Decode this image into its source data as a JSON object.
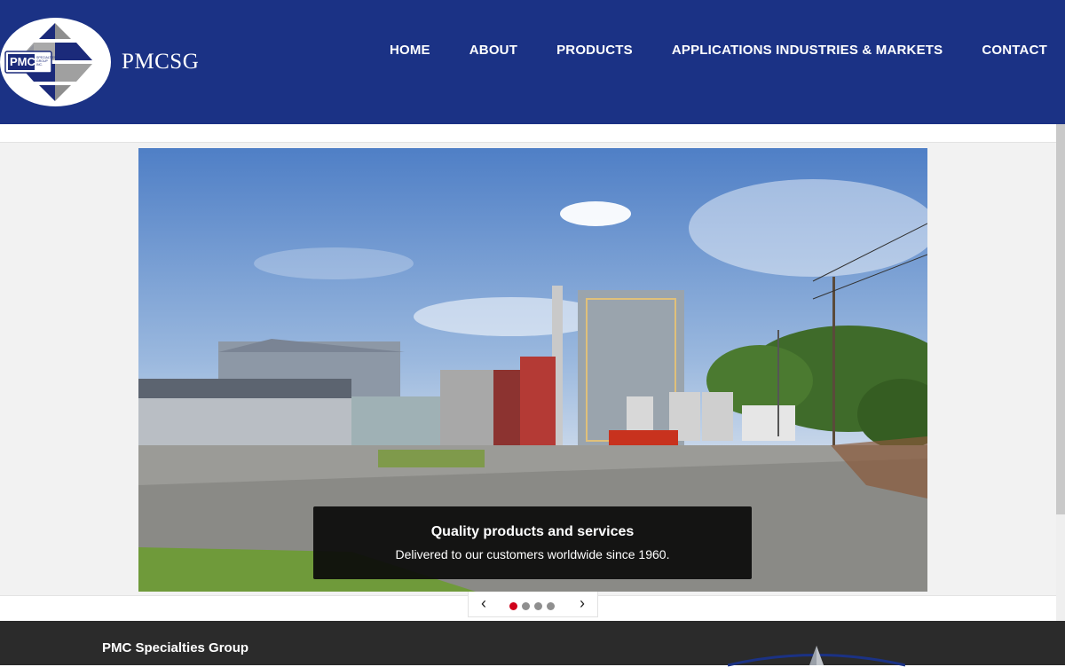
{
  "header": {
    "logo_text": "PMC",
    "logo_subtext": "SPECIALTIES GROUP INC.",
    "site_title": "PMCSG"
  },
  "nav": {
    "items": [
      {
        "label": "HOME"
      },
      {
        "label": "ABOUT"
      },
      {
        "label": "PRODUCTS"
      },
      {
        "label": "APPLICATIONS INDUSTRIES & MARKETS"
      },
      {
        "label": "CONTACT"
      }
    ]
  },
  "slider": {
    "caption_title": "Quality products and services",
    "caption_text": "Delivered to our customers worldwide since 1960.",
    "prev_icon": "chevron-left-icon",
    "next_icon": "chevron-right-icon",
    "slide_count": 4,
    "active_index": 0,
    "active_dot_color": "#d0021b",
    "inactive_dot_color": "#8f8f8f"
  },
  "footer": {
    "company_name": "PMC Specialties Group"
  },
  "colors": {
    "header_bg": "#1b3285",
    "footer_bg": "#2b2b2b"
  }
}
